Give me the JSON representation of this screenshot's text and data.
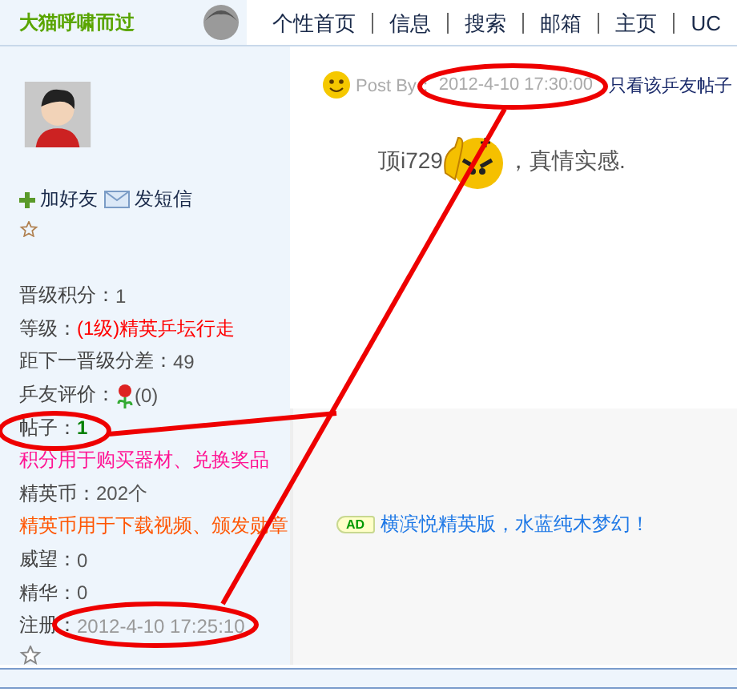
{
  "header": {
    "username": "大猫呼啸而过",
    "nav": [
      {
        "label": "个性首页"
      },
      {
        "label": "信息"
      },
      {
        "label": "搜索"
      },
      {
        "label": "邮箱"
      },
      {
        "label": "主页"
      },
      {
        "label": "UC"
      }
    ]
  },
  "profile": {
    "actions": [
      {
        "kind": "add",
        "label": "加好友"
      },
      {
        "kind": "mail",
        "label": "发短信"
      }
    ],
    "stats": [
      {
        "kind": "stat",
        "label": "晋级积分：",
        "value": "1"
      },
      {
        "kind": "stat",
        "label": "等级：",
        "value": "(1级)精英乒坛行走",
        "color": "#ff0000"
      },
      {
        "kind": "stat",
        "label": "距下一晋级分差：",
        "value": "49"
      },
      {
        "kind": "rating",
        "label": "乒友评价：",
        "value": "(0)"
      },
      {
        "kind": "count",
        "label": "帖子：",
        "value": "1",
        "color": "#008000"
      },
      {
        "kind": "note",
        "text": "积分用于购买器材、兑换奖品",
        "color": "#ff1493"
      },
      {
        "kind": "stat",
        "label": "精英币：",
        "value": "202个"
      },
      {
        "kind": "note",
        "text": "精英币用于下载视频、颁发勋章",
        "color": "#ff5500"
      },
      {
        "kind": "stat",
        "label": "威望：",
        "value": "0"
      },
      {
        "kind": "stat",
        "label": "精华：",
        "value": "0"
      },
      {
        "kind": "date",
        "label": "注册：",
        "value": "2012-4-10 17:25:10",
        "color": "#999999"
      }
    ]
  },
  "post": {
    "by_label": "Post By：",
    "time": "2012-4-10 17:30:00",
    "link": "只看该乒友帖子",
    "text_before": "顶i729",
    "text_after": "，真情实感."
  },
  "ad": {
    "badge": "AD",
    "text": "横滨悦精英版，水蓝纯木梦幻！"
  }
}
